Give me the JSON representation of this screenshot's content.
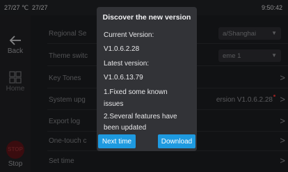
{
  "statusbar": {
    "temp1": "27/27 ℃",
    "temp2": "27/27",
    "time": "9:50:42"
  },
  "rail": {
    "back_label": "Back",
    "home_label": "Home",
    "stop_label": "Stop",
    "stop_icon_text": "STOP"
  },
  "settings": {
    "rows": [
      {
        "label": "Regional Se",
        "value": "a/Shanghai",
        "control": "dropdown"
      },
      {
        "label": "Theme switc",
        "value": "eme 1",
        "control": "dropdown"
      },
      {
        "label": "Key Tones",
        "value": "",
        "control": "chevron"
      },
      {
        "label": "System upg",
        "value": "ersion V1.0.6.2.28",
        "control": "chevron"
      },
      {
        "label": "Export log",
        "value": "",
        "control": "chevron"
      },
      {
        "label": "One-touch c",
        "value": "",
        "control": "chevron"
      },
      {
        "label": "Set time",
        "value": "",
        "control": "chevron"
      }
    ]
  },
  "dialog": {
    "title": "Discover the new version",
    "current_label": "Current Version:",
    "current_value": "V1.0.6.2.28",
    "latest_label": "Latest version:",
    "latest_value": "V1.0.6.13.79",
    "note1_line1": "1.Fixed some known",
    "note1_line2": "issues",
    "note2_line1": "2.Several features have",
    "note2_line2": "been updated",
    "next_label": "Next time",
    "download_label": "Download"
  },
  "colors": {
    "accent": "#1e9ae0",
    "background": "#1b1c1f",
    "dialog": "#323337",
    "stop": "#5a1317"
  }
}
